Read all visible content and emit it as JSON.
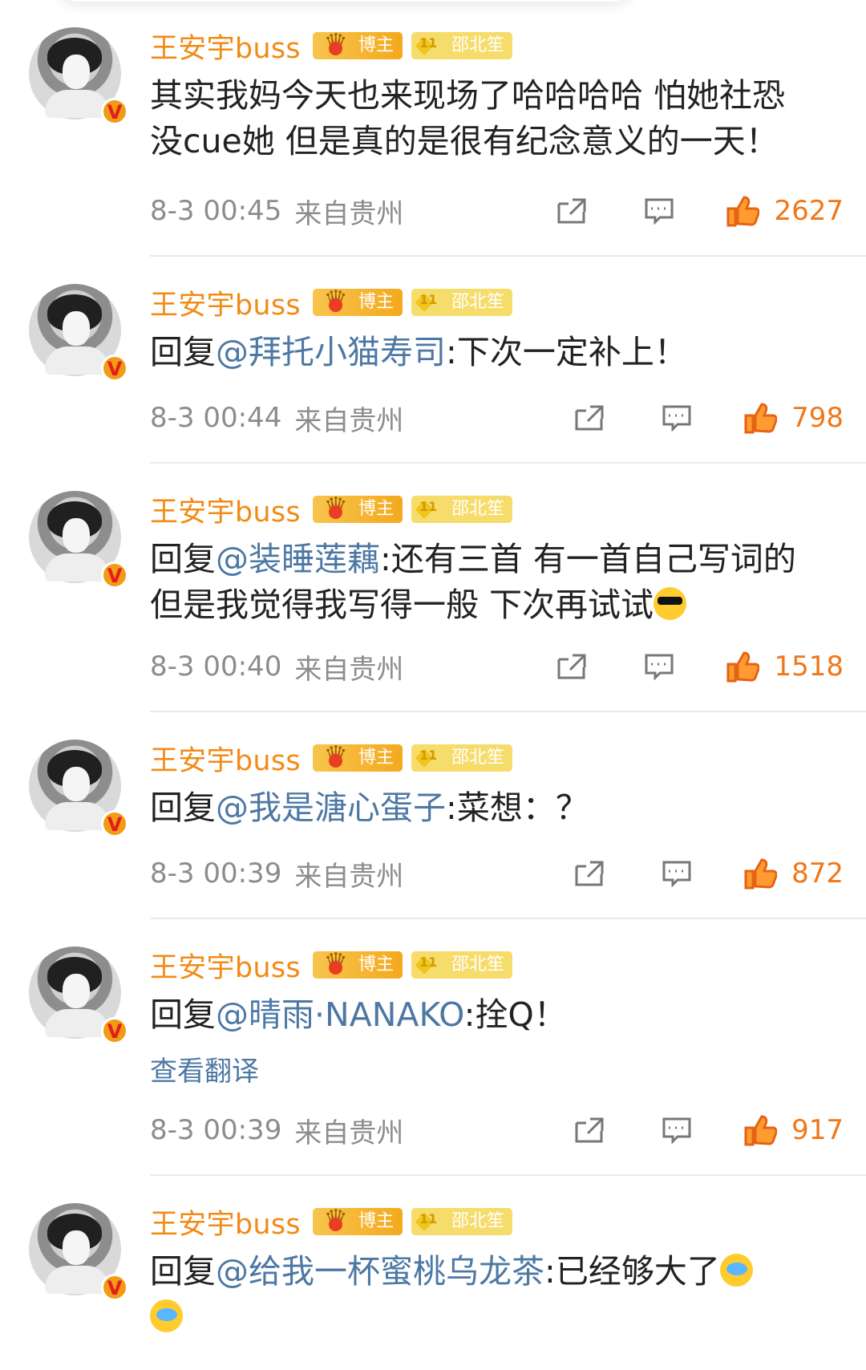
{
  "comments": [
    {
      "username": "王安宇buss",
      "badge_blogger": "博主",
      "badge_level_num": "11",
      "badge_level_name": "邵北笙",
      "text_parts": [
        "其实我妈今天也来现场了哈哈哈哈 怕她社恐没cue她 但是真的是很有纪念意义的一天！"
      ],
      "time": "8-3 00:45",
      "from": "来自贵州",
      "likes": "2627"
    },
    {
      "username": "王安宇buss",
      "badge_blogger": "博主",
      "badge_level_num": "11",
      "badge_level_name": "邵北笙",
      "reply_prefix": "回复",
      "mention": "@拜托小猫寿司",
      "reply_text": ":下次一定补上！",
      "time": "8-3 00:44",
      "from": "来自贵州",
      "likes": "798"
    },
    {
      "username": "王安宇buss",
      "badge_blogger": "博主",
      "badge_level_num": "11",
      "badge_level_name": "邵北笙",
      "reply_prefix": "回复",
      "mention": "@装睡莲藕",
      "reply_text": ":还有三首 有一首自己写词的 但是我觉得我写得一般 下次再试试",
      "time": "8-3 00:40",
      "from": "来自贵州",
      "likes": "1518"
    },
    {
      "username": "王安宇buss",
      "badge_blogger": "博主",
      "badge_level_num": "11",
      "badge_level_name": "邵北笙",
      "reply_prefix": "回复",
      "mention": "@我是溏心蛋子",
      "reply_text": ":菜想：？",
      "time": "8-3 00:39",
      "from": "来自贵州",
      "likes": "872"
    },
    {
      "username": "王安宇buss",
      "badge_blogger": "博主",
      "badge_level_num": "11",
      "badge_level_name": "邵北笙",
      "reply_prefix": "回复",
      "mention": "@晴雨·NANAKO",
      "reply_text": ":拴Q！",
      "translate": "查看翻译",
      "time": "8-3 00:39",
      "from": "来自贵州",
      "likes": "917"
    },
    {
      "username": "王安宇buss",
      "badge_blogger": "博主",
      "badge_level_num": "11",
      "badge_level_name": "邵北笙",
      "reply_prefix": "回复",
      "mention": "@给我一杯蜜桃乌龙茶",
      "reply_text": ":已经够大了"
    }
  ],
  "icons": {
    "share": "share-icon",
    "comment": "comment-icon",
    "like": "like-icon",
    "verified": "verified-icon",
    "crown": "crown-icon",
    "level": "level-diamond-icon",
    "cool_emoji": "cool-emoji-icon",
    "cry_emoji": "cry-emoji-icon"
  },
  "colors": {
    "username": "#f28b16",
    "mention": "#4d78a4",
    "meta": "#8c8c8c",
    "like": "#f07718",
    "divider": "#e9e9e9",
    "blogger_badge": "#f4a91e",
    "level_badge": "#f6dc6a"
  }
}
